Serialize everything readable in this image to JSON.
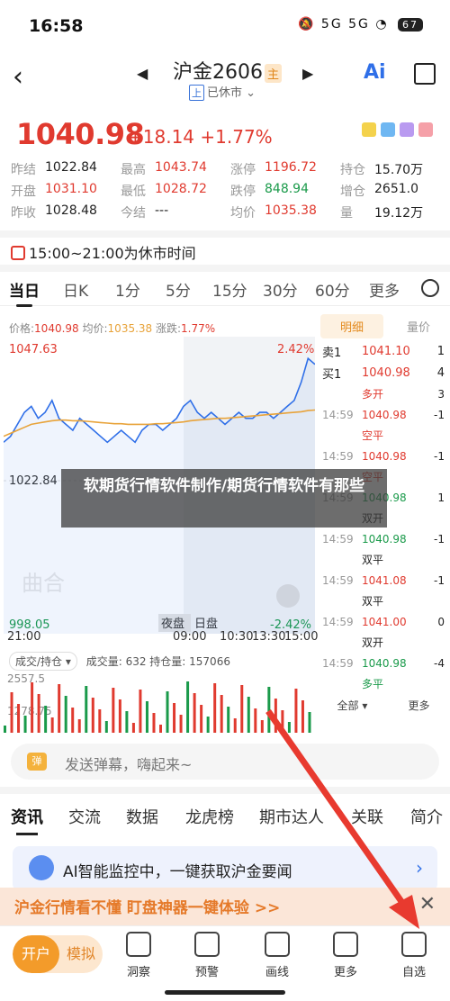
{
  "status": {
    "time": "16:58",
    "signal": "5G 5G",
    "battery": "67"
  },
  "header": {
    "title": "沪金2606",
    "title_tag": "主",
    "subtitle_badge": "上",
    "subtitle": "已休市",
    "ai_label": "Ai"
  },
  "quote": {
    "price": "1040.98",
    "change": "+18.14",
    "change_pct": "+1.77%",
    "rows": [
      [
        {
          "label": "昨结",
          "value": "1022.84",
          "tone": ""
        },
        {
          "label": "最高",
          "value": "1043.74",
          "tone": "red"
        },
        {
          "label": "涨停",
          "value": "1196.72",
          "tone": "red"
        },
        {
          "label": "持仓",
          "value": "15.70万",
          "tone": ""
        }
      ],
      [
        {
          "label": "开盘",
          "value": "1031.10",
          "tone": "red"
        },
        {
          "label": "最低",
          "value": "1028.72",
          "tone": "red"
        },
        {
          "label": "跌停",
          "value": "848.94",
          "tone": "green"
        },
        {
          "label": "增仓",
          "value": "2651.0",
          "tone": ""
        }
      ],
      [
        {
          "label": "昨收",
          "value": "1028.48",
          "tone": ""
        },
        {
          "label": "今结",
          "value": "---",
          "tone": ""
        },
        {
          "label": "均价",
          "value": "1035.38",
          "tone": "red"
        },
        {
          "label": "量",
          "value": "19.12万",
          "tone": ""
        }
      ]
    ]
  },
  "notice": "15:00~21:00为休市时间",
  "chart_tabs": [
    "当日",
    "日K",
    "1分",
    "5分",
    "15分",
    "30分",
    "60分",
    "更多"
  ],
  "info_line": {
    "price_label": "价格:",
    "price": "1040.98",
    "avg_label": "均价:",
    "avg": "1035.38",
    "chg_label": "涨跌:",
    "chg": "1.77%"
  },
  "chart_data": {
    "type": "line",
    "yaxis_labels": {
      "top": "1047.63",
      "mid": "1022.84",
      "bottom": "998.05",
      "top_pct": "2.42%",
      "bottom_pct": "-2.42%"
    },
    "x_labels": [
      "21:00",
      "09:00",
      "10:30",
      "13:30",
      "15:00"
    ],
    "session_labels": [
      "夜盘",
      "日盘"
    ],
    "watermark": "曲合",
    "ylim": [
      998.05,
      1047.63
    ],
    "series": [
      {
        "values": [
          1030,
          1031,
          1033,
          1035,
          1036,
          1034,
          1035,
          1037,
          1034,
          1033,
          1032,
          1034,
          1033,
          1032,
          1031,
          1030,
          1031,
          1032,
          1031,
          1030,
          1032,
          1033,
          1033,
          1032,
          1033,
          1034,
          1036,
          1037,
          1035,
          1034,
          1035,
          1034,
          1033,
          1034,
          1035,
          1034,
          1034,
          1035,
          1035,
          1034,
          1035,
          1036,
          1037,
          1040,
          1044,
          1043
        ]
      },
      {
        "values": [
          1031,
          1031.5,
          1032,
          1032.5,
          1033,
          1033.2,
          1033.4,
          1033.6,
          1033.7,
          1033.7,
          1033.6,
          1033.6,
          1033.5,
          1033.4,
          1033.3,
          1033.2,
          1033.1,
          1033.1,
          1033,
          1033,
          1033,
          1033,
          1033.1,
          1033.1,
          1033.2,
          1033.3,
          1033.4,
          1033.6,
          1033.7,
          1033.8,
          1033.9,
          1034,
          1034,
          1034.1,
          1034.2,
          1034.3,
          1034.4,
          1034.5,
          1034.6,
          1034.7,
          1034.8,
          1034.9,
          1035,
          1035.1,
          1035.3,
          1035.38
        ]
      }
    ]
  },
  "volume": {
    "selector": "成交/持仓",
    "text": "成交量: 632 持仓量: 157066",
    "top": "2557.5",
    "second": "1278.75"
  },
  "side": {
    "tabs": [
      "明细",
      "量价"
    ],
    "orderbook": [
      {
        "label": "卖1",
        "price": "1041.10",
        "qty": "1"
      },
      {
        "label": "买1",
        "price": "1040.98",
        "qty": "4"
      }
    ],
    "first_trade": {
      "type": "多开",
      "qty": "3"
    },
    "trades": [
      {
        "time": "14:59",
        "price": "1040.98",
        "ptone": "red",
        "type": "空平",
        "ttone": "red",
        "qty": "-1"
      },
      {
        "time": "14:59",
        "price": "1040.98",
        "ptone": "red",
        "type": "空平",
        "ttone": "red",
        "qty": "-1"
      },
      {
        "time": "14:59",
        "price": "1040.98",
        "ptone": "green",
        "type": "双开",
        "ttone": "",
        "qty": "1"
      },
      {
        "time": "14:59",
        "price": "1040.98",
        "ptone": "green",
        "type": "双平",
        "ttone": "",
        "qty": "-1"
      },
      {
        "time": "14:59",
        "price": "1041.08",
        "ptone": "red",
        "type": "双平",
        "ttone": "",
        "qty": "-1"
      },
      {
        "time": "14:59",
        "price": "1041.00",
        "ptone": "red",
        "type": "双开",
        "ttone": "",
        "qty": "0"
      },
      {
        "time": "14:59",
        "price": "1040.98",
        "ptone": "green",
        "type": "多平",
        "ttone": "green",
        "qty": "-4"
      }
    ],
    "footer": [
      "全部",
      "更多"
    ]
  },
  "overlay_text": "软期货行情软件制作/期货行情软件有那些",
  "danmu": {
    "icon": "弹",
    "placeholder": "发送弹幕，嗨起来~"
  },
  "news_tabs": [
    "资讯",
    "交流",
    "数据",
    "龙虎榜",
    "期市达人",
    "关联",
    "简介"
  ],
  "ai_banner": "AI智能监控中，一键获取沪金要闻",
  "promo": "沪金行情看不懂 盯盘神器一键体验 >>",
  "bottom": {
    "toggle_on": "开户",
    "toggle_off": "模拟",
    "nav": [
      "洞察",
      "预警",
      "画线",
      "更多",
      "自选"
    ]
  }
}
